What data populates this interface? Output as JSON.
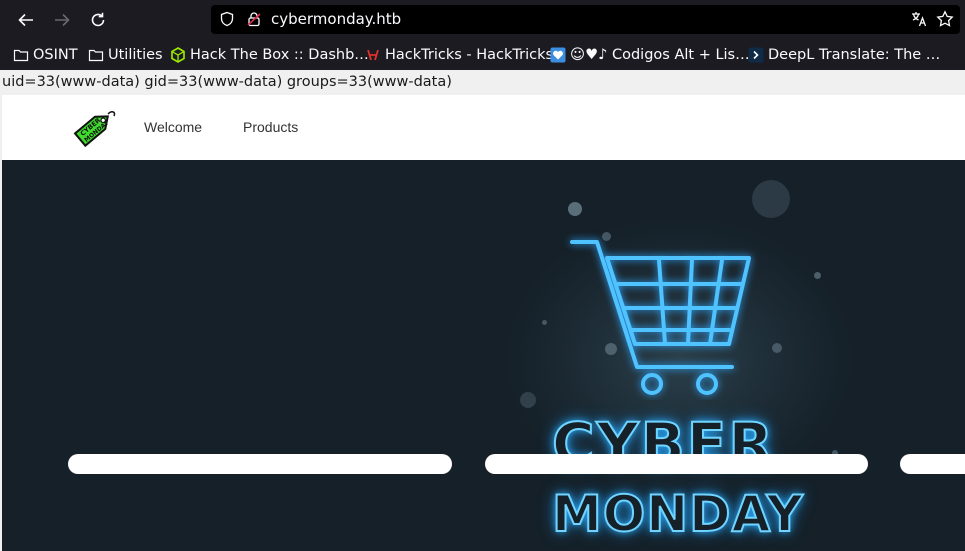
{
  "browser": {
    "url": "cybermonday.htb",
    "bookmarks": [
      {
        "label": "OSINT",
        "icon": "folder-icon"
      },
      {
        "label": "Utilities",
        "icon": "folder-icon"
      },
      {
        "label": "Hack The Box :: Dashb…",
        "icon": "hackthebox-icon"
      },
      {
        "label": "HackTricks - HackTricks",
        "icon": "hacktricks-icon"
      },
      {
        "label": "☺♥♪ Codigos Alt + Lis…",
        "icon": "heart-favicon-icon"
      },
      {
        "label": "DeepL Translate: The …",
        "icon": "deepl-icon"
      }
    ]
  },
  "page": {
    "command_output": "uid=33(www-data) gid=33(www-data) groups=33(www-data)",
    "logo_text": "CYBER MONDAY",
    "nav": {
      "welcome": "Welcome",
      "products": "Products"
    },
    "hero": {
      "line1": "CYBER",
      "line2": "MONDAY"
    }
  },
  "colors": {
    "hero_bg": "#152028",
    "neon": "#6fd4ff",
    "logo_green": "#3fdc2c"
  }
}
